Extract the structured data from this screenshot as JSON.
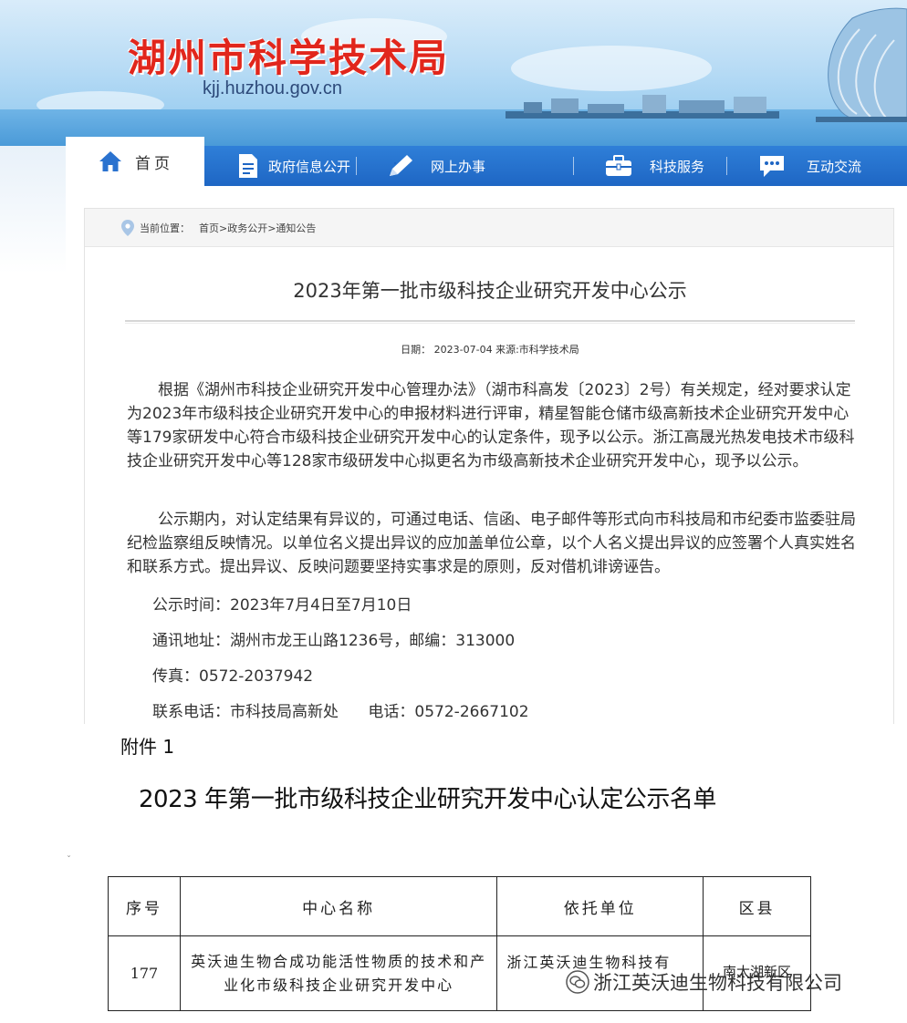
{
  "banner": {
    "site_title": "湖州市科学技术局",
    "site_url": "kjj.huzhou.gov.cn"
  },
  "nav": {
    "home": "首页",
    "items": [
      "政府信息公开",
      "网上办事",
      "科技服务",
      "互动交流"
    ]
  },
  "breadcrumb": {
    "prefix": "当前位置：",
    "path": "首页>政务公开>通知公告"
  },
  "article": {
    "title": "2023年第一批市级科技企业研究开发中心公示",
    "meta": "日期： 2023-07-04  来源:市科学技术局",
    "paragraph1": "根据《湖州市科技企业研究开发中心管理办法》（湖市科高发〔2023〕2号）有关规定，经对要求认定为2023年市级科技企业研究开发中心的申报材料进行评审，精星智能仓储市级高新技术企业研究开发中心等179家研发中心符合市级科技企业研究开发中心的认定条件，现予以公示。浙江高晟光热发电技术市级科技企业研究开发中心等128家市级研发中心拟更名为市级高新技术企业研究开发中心，现予以公示。",
    "paragraph2": "公示期内，对认定结果有异议的，可通过电话、信函、电子邮件等形式向市科技局和市纪委市监委驻局纪检监察组反映情况。以单位名义提出异议的应加盖单位公章，以个人名义提出异议的应签署个人真实姓名和联系方式。提出异议、反映问题要坚持实事求是的原则，反对借机诽谤诬告。",
    "period": "公示时间：2023年7月4日至7月10日",
    "address": "通讯地址：湖州市龙王山路1236号，邮编：313000",
    "fax": "传真：0572-2037942",
    "contact": "联系电话：市科技局高新处      电话：0572-2667102"
  },
  "attachment": {
    "label": "附件 1",
    "title": "2023 年第一批市级科技企业研究开发中心认定公示名单",
    "mark": "ˇ",
    "table": {
      "headers": [
        "序号",
        "中心名称",
        "依托单位",
        "区县"
      ],
      "rows": [
        [
          "177",
          "英沃迪生物合成功能活性物质的技术和产业化市级科技企业研究开发中心",
          "浙江英沃迪生物科技有",
          "南太湖新区"
        ]
      ]
    }
  },
  "watermark": {
    "text": "浙江英沃迪生物科技有限公司",
    "icon": "wechat-icon"
  },
  "colors": {
    "title_red": "#e1261c",
    "nav_blue": "#1e66c4"
  }
}
